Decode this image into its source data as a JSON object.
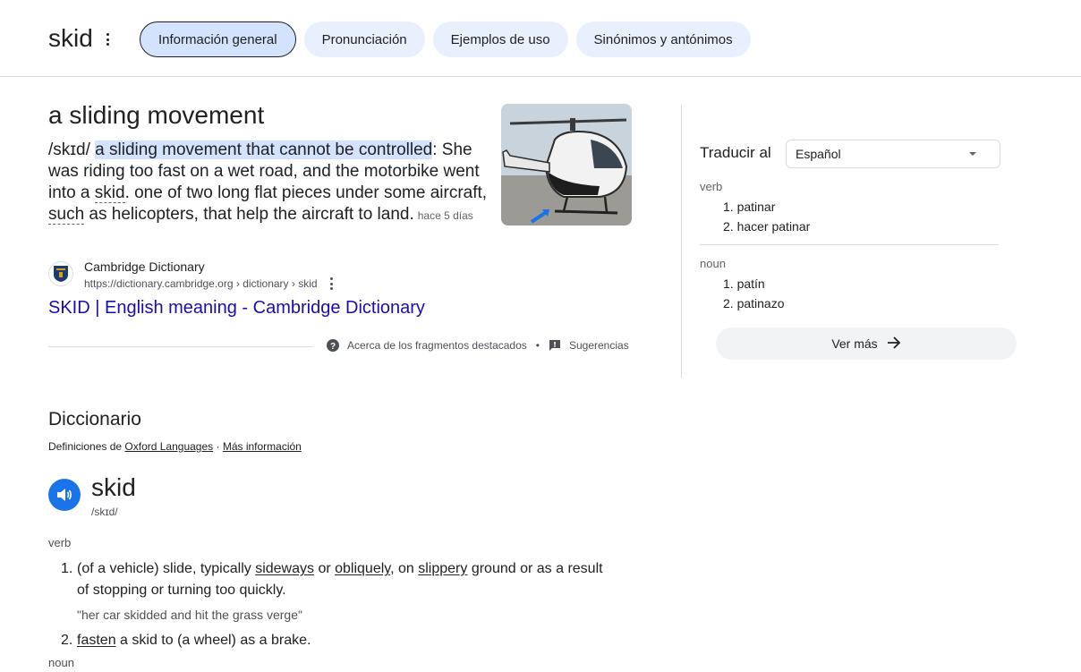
{
  "header": {
    "query": "skid",
    "tabs": [
      "Información general",
      "Pronunciación",
      "Ejemplos de uso",
      "Sinónimos y antónimos"
    ]
  },
  "snippet": {
    "heading": "a sliding movement",
    "phonetic": "/skɪd/",
    "highlight": "a sliding movement that cannot be controlled",
    "colon": ":",
    "text_a": "She was riding too fast on a wet road, and the motorbike went into a ",
    "text_skid": "skid",
    "text_b": ". one of two long flat pieces under some aircraft, ",
    "text_such": "such",
    "text_c": " as helicopters, that help the aircraft to land.",
    "age": "hace 5 días",
    "source_name": "Cambridge Dictionary",
    "source_url": "https://dictionary.cambridge.org › dictionary › skid",
    "link_title": "SKID | English meaning - Cambridge Dictionary",
    "about": "Acerca de los fragmentos destacados",
    "separator": "•",
    "feedback": "Sugerencias"
  },
  "translate": {
    "label": "Traducir al",
    "language": "Español",
    "groups": [
      {
        "pos": "verb",
        "items": [
          "patinar",
          "hacer patinar"
        ]
      },
      {
        "pos": "noun",
        "items": [
          "patín",
          "patinazo"
        ]
      }
    ],
    "more": "Ver más"
  },
  "dictionary": {
    "title": "Diccionario",
    "defs_from": "Definiciones de",
    "oxford": "Oxford Languages",
    "middot": " · ",
    "more_info": "Más información",
    "word": "skid",
    "phonetic": "/skɪd/",
    "pos_verb": "verb",
    "def1_num": "1.",
    "def1_a": "(of a vehicle) slide, typically ",
    "def1_sideways": "sideways",
    "def1_or": " or ",
    "def1_obliquely": "obliquely",
    "def1_on": ", on ",
    "def1_slippery": "slippery",
    "def1_b": " ground or as a result of stopping or turning too quickly.",
    "example1": "\"her car skidded and hit the grass verge\"",
    "def2_num": "2.",
    "def2_fasten": "fasten",
    "def2_b": " a skid to (a wheel) as a brake.",
    "pos_noun": "noun"
  },
  "colors": {
    "link": "#1a0dab",
    "highlight": "#d3e3fd",
    "tab_bg": "#e8f0fe",
    "speaker": "#1a73e8"
  },
  "icons": [
    "kebab-icon",
    "cambridge-logo-icon",
    "help-circle-icon",
    "feedback-icon",
    "dropdown-caret-icon",
    "arrow-right-icon",
    "speaker-icon"
  ]
}
